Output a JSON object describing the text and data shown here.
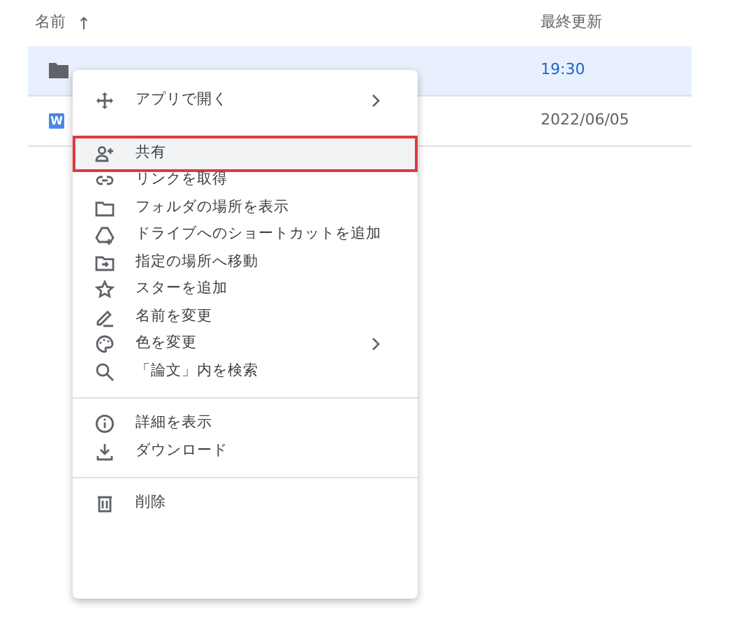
{
  "header": {
    "name_label": "名前",
    "sort_arrow": "↑",
    "modified_label": "最終更新"
  },
  "rows": [
    {
      "kind": "folder",
      "modified": "19:30",
      "selected": true
    },
    {
      "kind": "doc",
      "icon_text": "W",
      "modified": "2022/06/05",
      "selected": false
    }
  ],
  "context_menu": [
    {
      "kind": "item",
      "label": "アプリで開く",
      "submenu": true,
      "selected": false
    },
    {
      "kind": "item",
      "label": "共有",
      "submenu": false,
      "selected": true
    },
    {
      "kind": "item",
      "label": "リンクを取得",
      "submenu": false,
      "selected": false
    },
    {
      "kind": "item",
      "label": "フォルダの場所を表示",
      "submenu": false,
      "selected": false
    },
    {
      "kind": "item",
      "label": "ドライブへのショートカットを追加",
      "submenu": false,
      "selected": false
    },
    {
      "kind": "item",
      "label": "指定の場所へ移動",
      "submenu": false,
      "selected": false
    },
    {
      "kind": "item",
      "label": "スターを追加",
      "submenu": false,
      "selected": false
    },
    {
      "kind": "item",
      "label": "名前を変更",
      "submenu": false,
      "selected": false
    },
    {
      "kind": "item",
      "label": "色を変更",
      "submenu": true,
      "selected": false
    },
    {
      "kind": "item",
      "label": "「論文」内を検索",
      "submenu": false,
      "selected": false
    },
    {
      "kind": "divider"
    },
    {
      "kind": "item",
      "label": "詳細を表示",
      "submenu": false,
      "selected": false
    },
    {
      "kind": "item",
      "label": "ダウンロード",
      "submenu": false,
      "selected": false
    },
    {
      "kind": "divider"
    },
    {
      "kind": "item",
      "label": "削除",
      "submenu": false,
      "selected": false
    }
  ]
}
